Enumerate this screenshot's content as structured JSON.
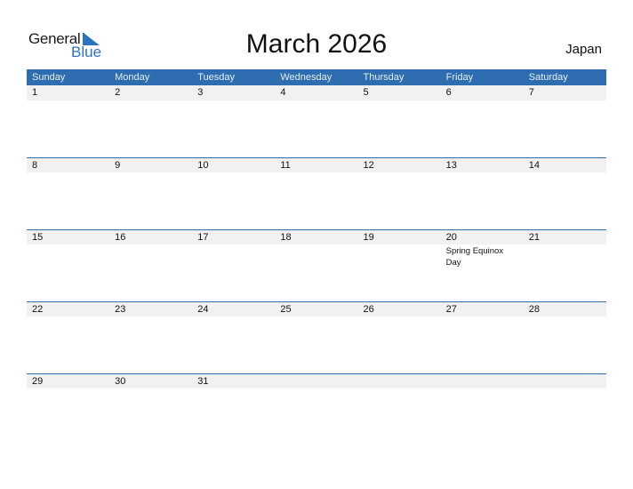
{
  "logo": {
    "line1": "General",
    "line2": "Blue"
  },
  "title": "March 2026",
  "country": "Japan",
  "colors": {
    "header_bg": "#2e6db0",
    "accent": "#2a73c0",
    "date_strip": "#f1f1f1"
  },
  "weekdays": [
    "Sunday",
    "Monday",
    "Tuesday",
    "Wednesday",
    "Thursday",
    "Friday",
    "Saturday"
  ],
  "weeks": [
    [
      {
        "day": "1",
        "event": ""
      },
      {
        "day": "2",
        "event": ""
      },
      {
        "day": "3",
        "event": ""
      },
      {
        "day": "4",
        "event": ""
      },
      {
        "day": "5",
        "event": ""
      },
      {
        "day": "6",
        "event": ""
      },
      {
        "day": "7",
        "event": ""
      }
    ],
    [
      {
        "day": "8",
        "event": ""
      },
      {
        "day": "9",
        "event": ""
      },
      {
        "day": "10",
        "event": ""
      },
      {
        "day": "11",
        "event": ""
      },
      {
        "day": "12",
        "event": ""
      },
      {
        "day": "13",
        "event": ""
      },
      {
        "day": "14",
        "event": ""
      }
    ],
    [
      {
        "day": "15",
        "event": ""
      },
      {
        "day": "16",
        "event": ""
      },
      {
        "day": "17",
        "event": ""
      },
      {
        "day": "18",
        "event": ""
      },
      {
        "day": "19",
        "event": ""
      },
      {
        "day": "20",
        "event": "Spring Equinox Day"
      },
      {
        "day": "21",
        "event": ""
      }
    ],
    [
      {
        "day": "22",
        "event": ""
      },
      {
        "day": "23",
        "event": ""
      },
      {
        "day": "24",
        "event": ""
      },
      {
        "day": "25",
        "event": ""
      },
      {
        "day": "26",
        "event": ""
      },
      {
        "day": "27",
        "event": ""
      },
      {
        "day": "28",
        "event": ""
      }
    ],
    [
      {
        "day": "29",
        "event": ""
      },
      {
        "day": "30",
        "event": ""
      },
      {
        "day": "31",
        "event": ""
      },
      {
        "day": "",
        "event": ""
      },
      {
        "day": "",
        "event": ""
      },
      {
        "day": "",
        "event": ""
      },
      {
        "day": "",
        "event": ""
      }
    ]
  ]
}
